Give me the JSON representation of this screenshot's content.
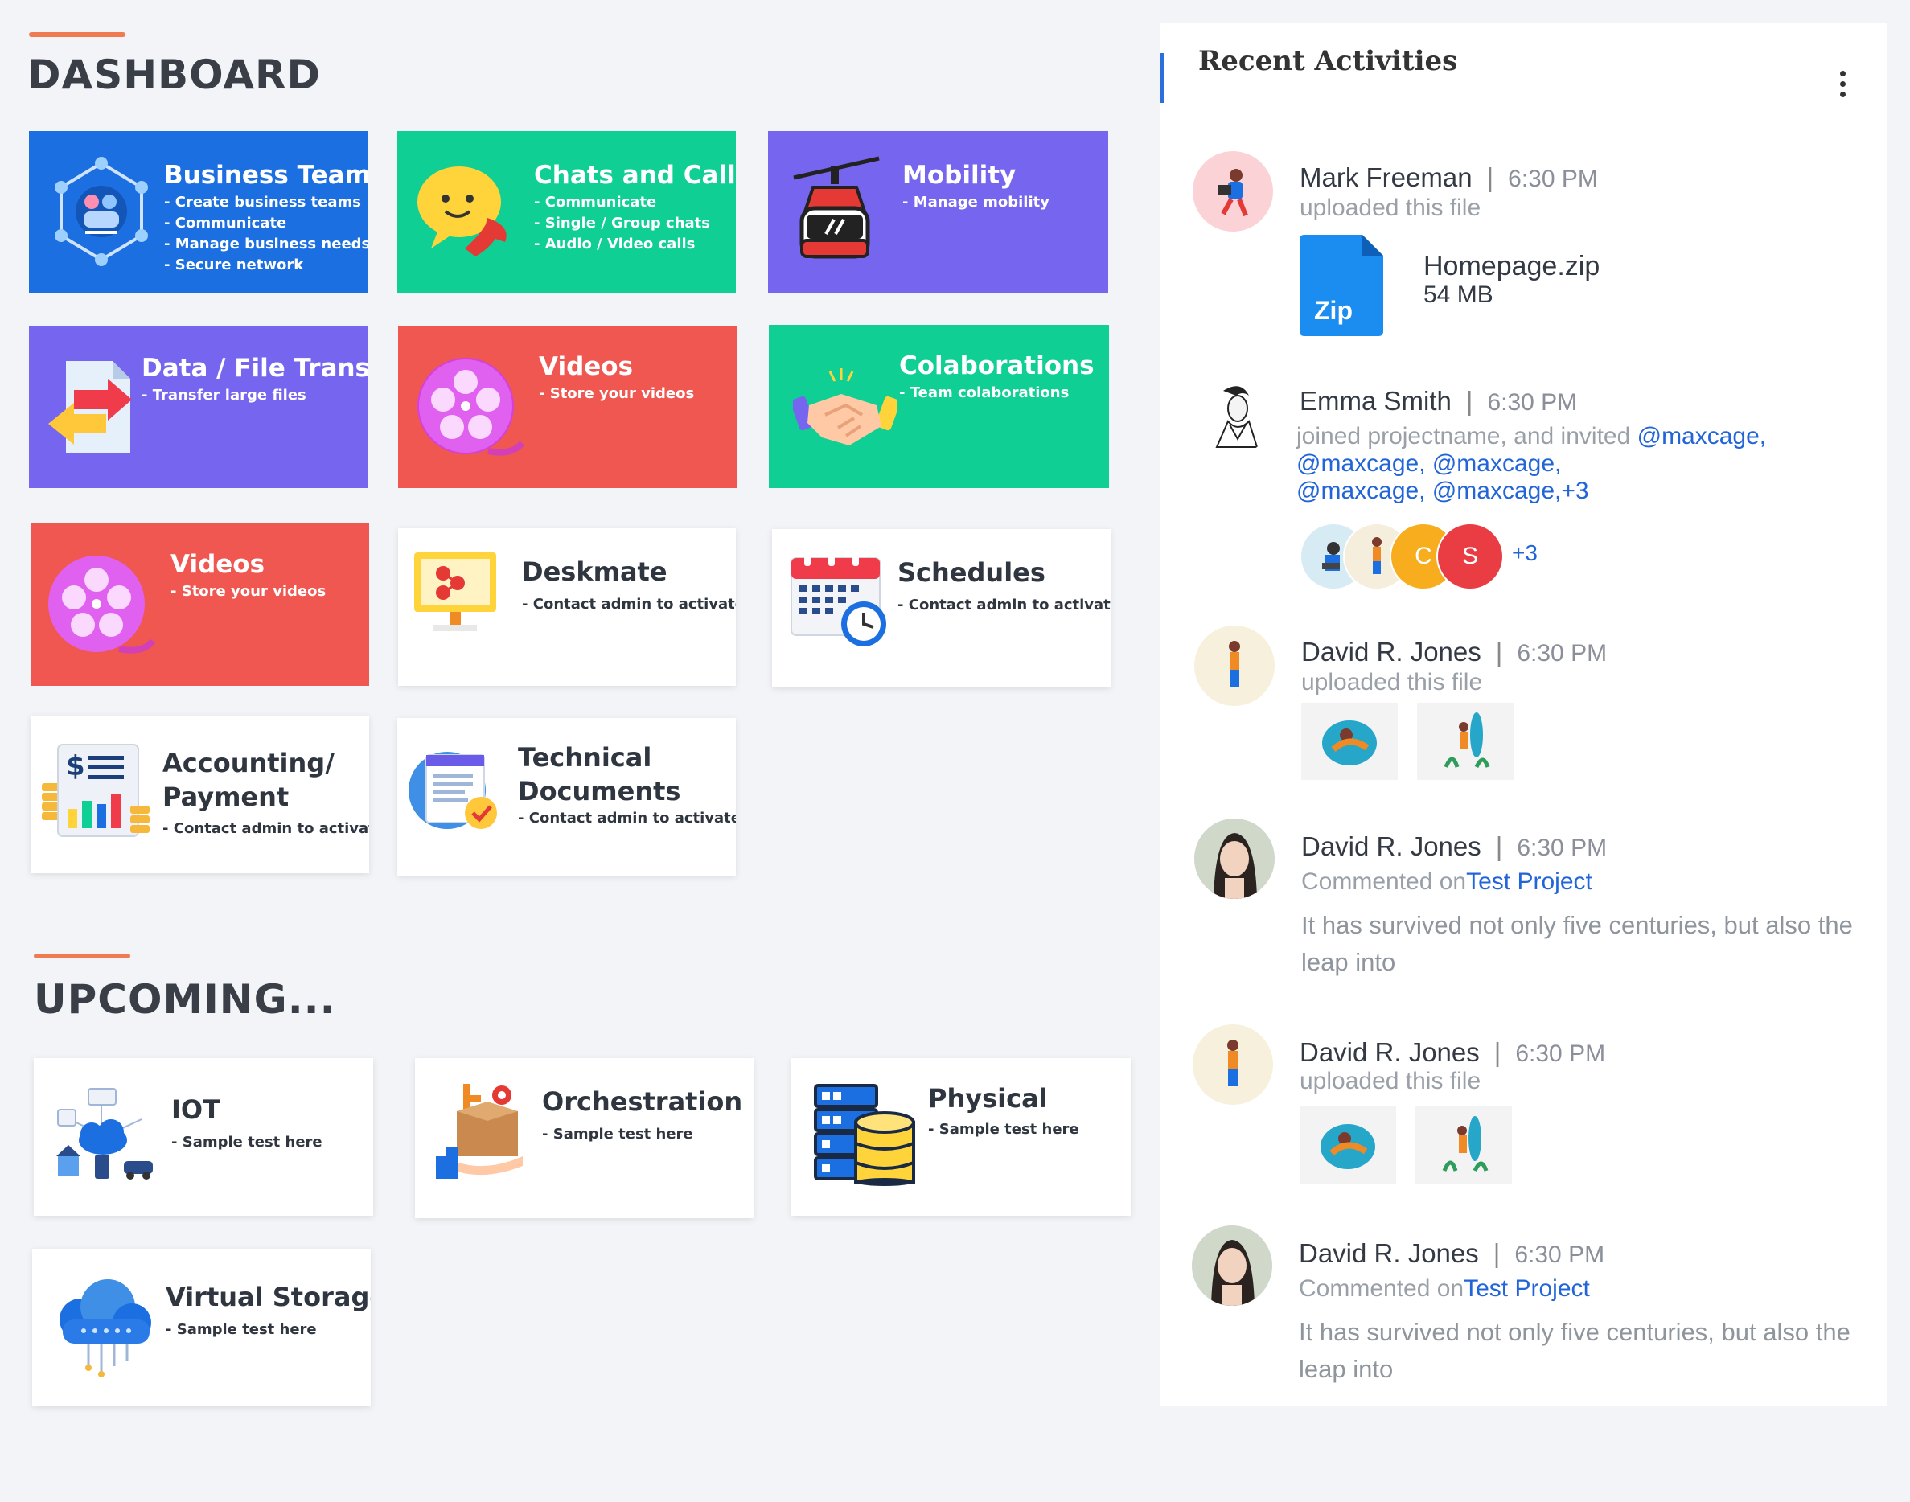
{
  "dashboard": {
    "title": "DASHBOARD"
  },
  "upcoming": {
    "title": "UPCOMING..."
  },
  "tiles": [
    {
      "title": "Business Teams",
      "lines": [
        "- Create business teams",
        "- Communicate",
        "- Manage business needs",
        "- Secure network"
      ]
    },
    {
      "title": "Chats and Calls",
      "lines": [
        "- Communicate",
        "- Single / Group chats",
        "- Audio / Video calls"
      ]
    },
    {
      "title": "Mobility",
      "lines": [
        "- Manage mobility"
      ]
    },
    {
      "title": "Data / File Transfer",
      "lines": [
        "- Transfer large files"
      ]
    },
    {
      "title": "Videos",
      "lines": [
        "- Store your videos"
      ]
    },
    {
      "title": "Colaborations",
      "lines": [
        "- Team colaborations"
      ]
    },
    {
      "title": "Videos",
      "lines": [
        "- Store your videos"
      ]
    },
    {
      "title": "Deskmate",
      "lines": [
        "- Contact admin to activate"
      ]
    },
    {
      "title": "Schedules",
      "lines": [
        "- Contact admin to activate"
      ]
    },
    {
      "title_lines": [
        "Accounting/",
        "Payment"
      ],
      "lines": [
        "- Contact admin to activate"
      ]
    },
    {
      "title_lines": [
        "Technical",
        "Documents"
      ],
      "lines": [
        "- Contact admin to activate"
      ]
    }
  ],
  "upcoming_tiles": [
    {
      "title": "IOT",
      "lines": [
        "- Sample test here"
      ]
    },
    {
      "title": "Orchestration",
      "lines": [
        "- Sample test here"
      ]
    },
    {
      "title": "Physical",
      "lines": [
        "- Sample test here"
      ]
    },
    {
      "title": "Virtual Storage",
      "lines": [
        "- Sample test here"
      ]
    }
  ],
  "colors": {
    "blue": "#1b6fe0",
    "green": "#10cf94",
    "purple": "#7665ee",
    "red": "#ef5750",
    "accent": "#f07a52",
    "link": "#2265d8"
  },
  "activities": {
    "title": "Recent Activities",
    "items": [
      {
        "name": "Mark Freeman",
        "time": "6:30 PM",
        "action": "uploaded this file",
        "file_name": "Homepage.zip",
        "file_size": "54 MB",
        "file_badge": "Zip"
      },
      {
        "name": "Emma Smith",
        "time": "6:30 PM",
        "action_prefix": "joined projectname, and invited ",
        "mentions_1": "@maxcage,",
        "mentions_2": "@maxcage, @maxcage,",
        "mentions_3": "@maxcage, @maxcage,+3",
        "avatar_letters": [
          "C",
          "S"
        ],
        "more": "+3"
      },
      {
        "name": "David R. Jones",
        "time": "6:30 PM",
        "action": "uploaded this file"
      },
      {
        "name": "David R. Jones",
        "time": "6:30 PM",
        "action_prefix": "Commented on",
        "link": "Test Project",
        "comment": "It has survived not only five centuries, but also the leap into"
      },
      {
        "name": "David R. Jones",
        "time": "6:30 PM",
        "action": "uploaded this file"
      },
      {
        "name": "David R. Jones",
        "time": "6:30 PM",
        "action_prefix": "Commented on",
        "link": "Test Project",
        "comment": "It has survived not only five centuries, but also the leap into"
      }
    ]
  }
}
